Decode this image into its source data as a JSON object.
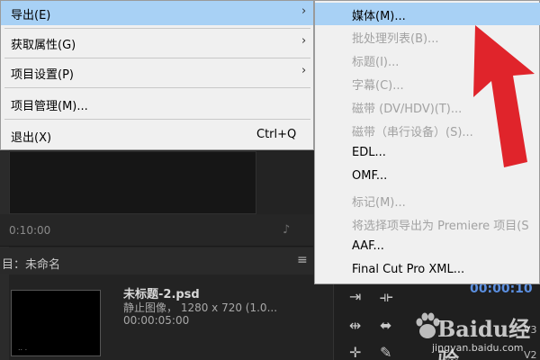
{
  "menu": {
    "items": [
      {
        "label": "导出(E)",
        "arrow": "›"
      },
      {
        "label": "获取属性(G)",
        "arrow": "›"
      },
      {
        "label": "项目设置(P)",
        "arrow": "›"
      },
      {
        "label": "项目管理(M)..."
      },
      {
        "label": "退出(X)",
        "shortcut": "Ctrl+Q"
      }
    ]
  },
  "submenu": {
    "items": [
      {
        "label": "媒体(M)...",
        "disabled": false
      },
      {
        "label": "批处理列表(B)...",
        "disabled": true
      },
      {
        "label": "标题(I)...",
        "disabled": true
      },
      {
        "label": "字幕(C)...",
        "disabled": true
      },
      {
        "label": "磁带 (DV/HDV)(T)...",
        "disabled": true
      },
      {
        "label": "磁带（串行设备）(S)...",
        "disabled": true
      },
      {
        "label": "EDL...",
        "disabled": false
      },
      {
        "label": "OMF...",
        "disabled": false
      },
      {
        "label": "标记(M)...",
        "disabled": true
      },
      {
        "label": "将选择项导出为 Premiere 项目(S",
        "disabled": true
      },
      {
        "label": "AAF...",
        "disabled": false
      },
      {
        "label": "Final Cut Pro XML...",
        "disabled": false
      }
    ]
  },
  "monitor": {
    "timecode": "0:10:00"
  },
  "project": {
    "title": "目：未命名",
    "clip_name": "未标题-2.psd",
    "clip_type": "静止图像， 1280 x 720 (1.0...",
    "clip_duration": "00:00:05:00"
  },
  "sequence": {
    "time": "00:00:10",
    "tracks": [
      "V3",
      "V2"
    ]
  },
  "watermark": {
    "brand": "Baidu经验",
    "url": "jingyan.baidu.com"
  },
  "colors": {
    "highlight": "#a8d1f5",
    "annotation_arrow": "#e0242b",
    "timecode_blue": "#5b8fe0"
  }
}
